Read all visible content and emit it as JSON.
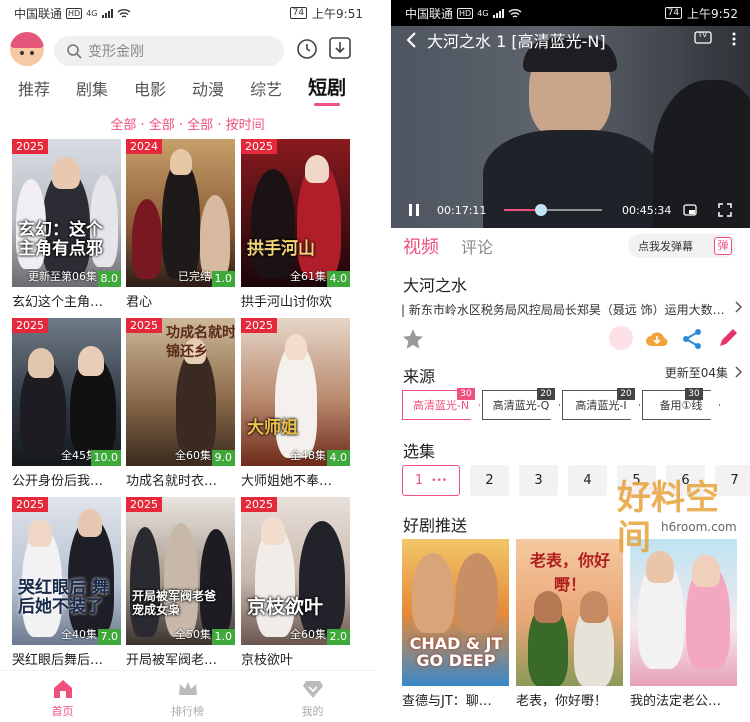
{
  "left": {
    "status_bar": {
      "carrier": "中国联通",
      "hd": "HD",
      "net": "4G",
      "battery": "74",
      "time": "上午9:51"
    },
    "search": {
      "placeholder": "变形金刚"
    },
    "tabs": [
      {
        "label": "推荐"
      },
      {
        "label": "剧集"
      },
      {
        "label": "电影"
      },
      {
        "label": "动漫"
      },
      {
        "label": "综艺"
      },
      {
        "label": "短剧"
      }
    ],
    "active_tab": "短剧",
    "filters": "全部 · 全部 · 全部 · 按时间",
    "cards": [
      {
        "year": "2025",
        "status": "更新至第06集",
        "score": "8.0",
        "title": "玄幻这个主角…",
        "poster_text": "玄幻：这个主角有点邪"
      },
      {
        "year": "2024",
        "status": "已完结",
        "score": "1.0",
        "title": "君心",
        "poster_text": ""
      },
      {
        "year": "2025",
        "status": "全61集",
        "score": "4.0",
        "title": "拱手河山讨你欢",
        "poster_text": "拱手河山"
      },
      {
        "year": "2025",
        "status": "全45集",
        "score": "10.0",
        "title": "公开身份后我…",
        "poster_text": ""
      },
      {
        "year": "2025",
        "status": "全60集",
        "score": "9.0",
        "title": "功成名就时衣…",
        "poster_text": "功成名就时 衣锦还乡"
      },
      {
        "year": "2025",
        "status": "全48集",
        "score": "4.0",
        "title": "大师姐她不奉…",
        "poster_text": "大师姐"
      },
      {
        "year": "2025",
        "status": "全40集",
        "score": "7.0",
        "title": "哭红眼后舞后…",
        "poster_text": "哭红眼后 舞后她不装了"
      },
      {
        "year": "2025",
        "status": "全50集",
        "score": "1.0",
        "title": "开局被军阀老…",
        "poster_text": "开局被军阀老爸 宠成女枭"
      },
      {
        "year": "2025",
        "status": "全60集",
        "score": "2.0",
        "title": "京枝欲叶",
        "poster_text": "京枝欲叶"
      }
    ],
    "bottom_nav": [
      {
        "label": "首页"
      },
      {
        "label": "排行榜"
      },
      {
        "label": "我的"
      }
    ],
    "colors": {
      "accent": "#f0507e",
      "year_badge": "#e5283a",
      "score_badge": "#3fa83a"
    }
  },
  "right": {
    "status_bar": {
      "carrier": "中国联通",
      "hd": "HD",
      "net": "4G",
      "battery": "74",
      "time": "上午9:52"
    },
    "player": {
      "title": "大河之水 1 [高清蓝光-N]",
      "tv_label": "TV",
      "current_time": "00:17:11",
      "total_time": "00:45:34",
      "progress": 0.377
    },
    "tabs": [
      {
        "label": "视频"
      },
      {
        "label": "评论"
      }
    ],
    "danmu": {
      "placeholder": "点我发弹幕",
      "icon": "弹"
    },
    "show": {
      "title": "大河之水",
      "description": "| 新东市岭水区税务局风控局局长郑昊（聂远 饰）运用大数…"
    },
    "sources": {
      "heading": "来源",
      "update": "更新至04集",
      "items": [
        {
          "label": "高清蓝光-N",
          "count": "30"
        },
        {
          "label": "高清蓝光-Q",
          "count": "20"
        },
        {
          "label": "高清蓝光-I",
          "count": "20"
        },
        {
          "label": "备用①线",
          "count": "30"
        }
      ]
    },
    "episodes": {
      "heading": "选集",
      "items": [
        "1",
        "2",
        "3",
        "4",
        "5",
        "6",
        "7"
      ]
    },
    "recommend": {
      "heading": "好剧推送",
      "items": [
        {
          "title": "查德与JT：聊…",
          "poster_text": "CHAD & JT GO DEEP"
        },
        {
          "title": "老表，你好嘢！",
          "poster_text": "老表，你好嘢！"
        },
        {
          "title": "我的法定老公…",
          "poster_text": ""
        }
      ]
    },
    "watermark": {
      "brand": "好料空间",
      "domain": "h6room.com"
    }
  }
}
